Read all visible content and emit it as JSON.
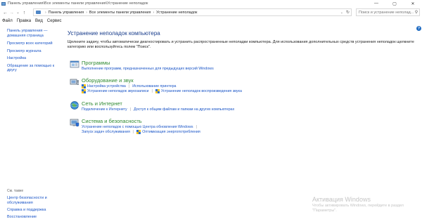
{
  "window": {
    "title": "Панель управления\\Все элементы панели управления\\Устранение неполадок",
    "controls": [
      "—",
      "▢",
      "✕"
    ]
  },
  "address": {
    "crumbs": [
      "Панель управления",
      "Все элементы панели управления",
      "Устранение неполадок"
    ],
    "search_placeholder": "Поиск и устранение неполад..."
  },
  "menu": [
    "Файл",
    "Правка",
    "Вид",
    "Сервис"
  ],
  "sidebar": {
    "links": [
      "Панель управления — домашняя страница",
      "Просмотр всех категорий",
      "Просмотр журнала",
      "Настройка",
      "Обращение за помощью к другу"
    ],
    "see_also_label": "См. также",
    "see_also": [
      "Центр безопасности и обслуживания",
      "Справка и поддержка",
      "Восстановление"
    ]
  },
  "main": {
    "title": "Устранение неполадок компьютера",
    "intro": "Щелкните задачу, чтобы автоматически диагностировать и устранить распространенные неполадки компьютера. Для использования дополнительных средств устранения неполадок щелкните категорию или воспользуйтесь полем \"Поиск\".",
    "categories": [
      {
        "title": "Программы",
        "rows": [
          [
            {
              "label": "Выполнение программ, предназначенных для предыдущих версий Windows",
              "shield": false
            }
          ]
        ]
      },
      {
        "title": "Оборудование и звук",
        "rows": [
          [
            {
              "label": "Настройка устройства",
              "shield": true
            },
            {
              "label": "Использование принтера",
              "shield": false
            }
          ],
          [
            {
              "label": "Устранение неполадок звукозаписи",
              "shield": true
            },
            {
              "label": "Устранение неполадок воспроизведения звука",
              "shield": true
            }
          ]
        ]
      },
      {
        "title": "Сеть и Интернет",
        "rows": [
          [
            {
              "label": "Подключение к Интернету",
              "shield": false
            },
            {
              "label": "Доступ к общим файлам и папкам на других компьютерах",
              "shield": false
            }
          ]
        ]
      },
      {
        "title": "Система и безопасность",
        "rows": [
          [
            {
              "label": "Устранение неполадок с помощью Центра обновления Windows",
              "shield": false
            }
          ],
          [
            {
              "label": "Запуск задач обслуживания",
              "shield": false
            },
            {
              "label": "Оптимизация энергопотребления",
              "shield": true
            }
          ]
        ]
      }
    ]
  },
  "watermark": {
    "title": "Активация Windows",
    "text": "Чтобы активировать Windows, перейдите в раздел \"Параметры\"."
  },
  "colors": {
    "link": "#1a55c7",
    "category": "#2f8a32",
    "heading": "#1a3e8c"
  }
}
